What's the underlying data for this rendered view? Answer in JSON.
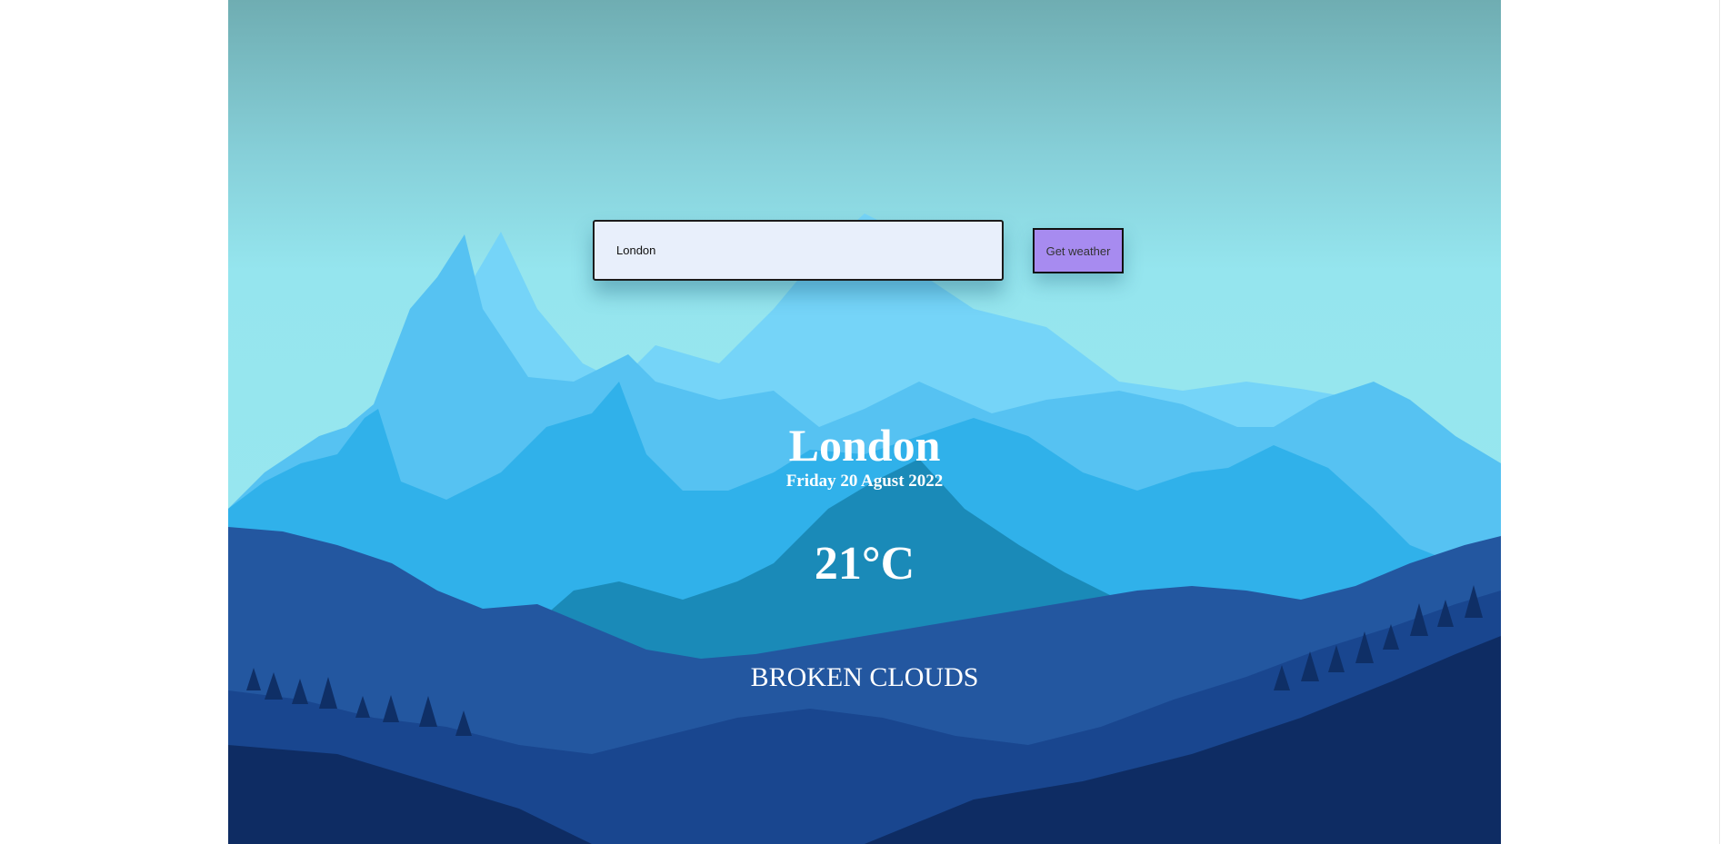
{
  "search": {
    "value": "London",
    "button_label": "Get weather"
  },
  "weather": {
    "city": "London",
    "date": "Friday 20 Agust 2022",
    "temperature": "21°C",
    "description": "BROKEN CLOUDS"
  },
  "colors": {
    "sky_top": "#6fadb2",
    "sky_bottom": "#98e6ef",
    "button_bg": "#a78bf0",
    "input_bg": "#e8effb",
    "text": "#ffffff"
  }
}
